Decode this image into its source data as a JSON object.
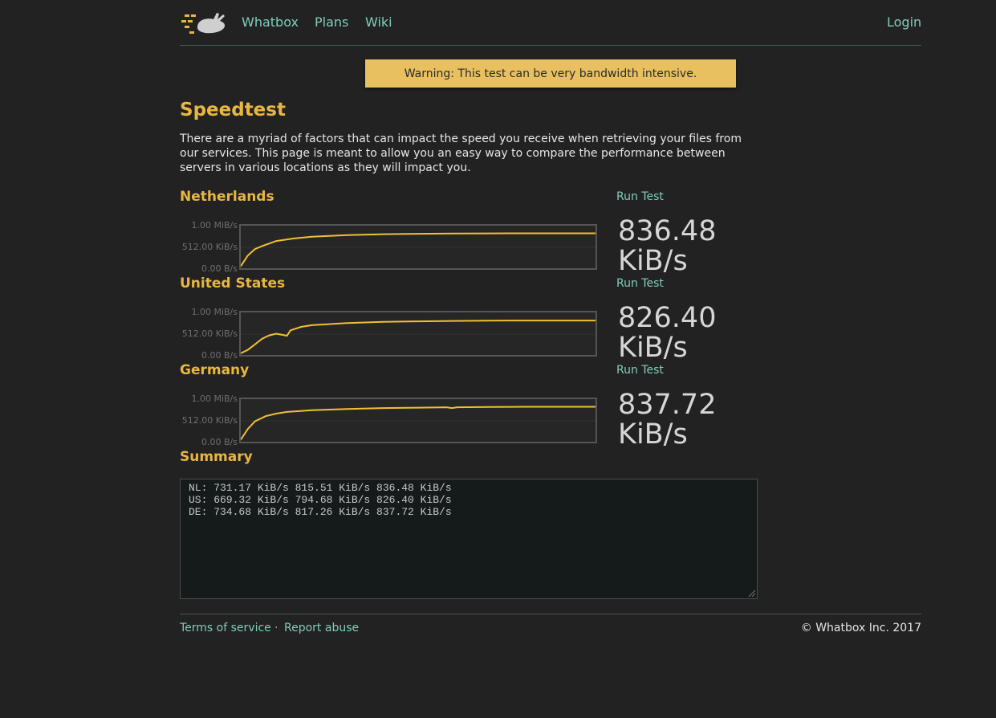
{
  "nav": {
    "brand_label": "Whatbox",
    "plans_label": "Plans",
    "wiki_label": "Wiki",
    "login_label": "Login"
  },
  "warning": "Warning: This test can be very bandwidth intensive.",
  "page_title": "Speedtest",
  "intro": "There are a myriad of factors that can impact the speed you receive when retrieving your files from our services. This page is meant to allow you an easy way to compare the performance between servers in various locations as they will impact you.",
  "axis_labels": {
    "top": "1.00 MiB/s",
    "mid": "512.00 KiB/s",
    "bottom": "0.00 B/s"
  },
  "axis_max_kib": 1024,
  "line_color": "#f2c032",
  "servers": [
    {
      "name": "Netherlands",
      "run_label": "Run Test",
      "speed_value": "836.48",
      "speed_unit": "KiB/s",
      "curve": [
        [
          0,
          0.05
        ],
        [
          0.02,
          0.3
        ],
        [
          0.04,
          0.45
        ],
        [
          0.06,
          0.52
        ],
        [
          0.1,
          0.64
        ],
        [
          0.15,
          0.7
        ],
        [
          0.2,
          0.74
        ],
        [
          0.3,
          0.78
        ],
        [
          0.4,
          0.8
        ],
        [
          0.5,
          0.81
        ],
        [
          0.6,
          0.815
        ],
        [
          0.7,
          0.818
        ],
        [
          0.8,
          0.82
        ],
        [
          0.9,
          0.82
        ],
        [
          1,
          0.82
        ]
      ]
    },
    {
      "name": "United States",
      "run_label": "Run Test",
      "speed_value": "826.40",
      "speed_unit": "KiB/s",
      "curve": [
        [
          0,
          0.04
        ],
        [
          0.02,
          0.12
        ],
        [
          0.04,
          0.25
        ],
        [
          0.06,
          0.38
        ],
        [
          0.08,
          0.46
        ],
        [
          0.1,
          0.5
        ],
        [
          0.12,
          0.47
        ],
        [
          0.13,
          0.45
        ],
        [
          0.14,
          0.58
        ],
        [
          0.17,
          0.66
        ],
        [
          0.2,
          0.7
        ],
        [
          0.3,
          0.75
        ],
        [
          0.4,
          0.78
        ],
        [
          0.5,
          0.79
        ],
        [
          0.6,
          0.8
        ],
        [
          0.7,
          0.805
        ],
        [
          0.8,
          0.81
        ],
        [
          0.9,
          0.81
        ],
        [
          1,
          0.81
        ]
      ]
    },
    {
      "name": "Germany",
      "run_label": "Run Test",
      "speed_value": "837.72",
      "speed_unit": "KiB/s",
      "curve": [
        [
          0,
          0.05
        ],
        [
          0.02,
          0.3
        ],
        [
          0.04,
          0.48
        ],
        [
          0.07,
          0.6
        ],
        [
          0.1,
          0.66
        ],
        [
          0.13,
          0.7
        ],
        [
          0.2,
          0.74
        ],
        [
          0.3,
          0.77
        ],
        [
          0.4,
          0.79
        ],
        [
          0.5,
          0.8
        ],
        [
          0.58,
          0.81
        ],
        [
          0.595,
          0.79
        ],
        [
          0.61,
          0.81
        ],
        [
          0.7,
          0.815
        ],
        [
          0.8,
          0.82
        ],
        [
          0.9,
          0.82
        ],
        [
          1,
          0.82
        ]
      ]
    }
  ],
  "summary_title": "Summary",
  "summary_lines": [
    "NL: 731.17 KiB/s 815.51 KiB/s 836.48 KiB/s",
    "US: 669.32 KiB/s 794.68 KiB/s 826.40 KiB/s",
    "DE: 734.68 KiB/s 817.26 KiB/s 837.72 KiB/s"
  ],
  "footer": {
    "terms_label": "Terms of service",
    "separator": "·",
    "abuse_label": "Report abuse",
    "copyright": "© Whatbox Inc. 2017"
  }
}
